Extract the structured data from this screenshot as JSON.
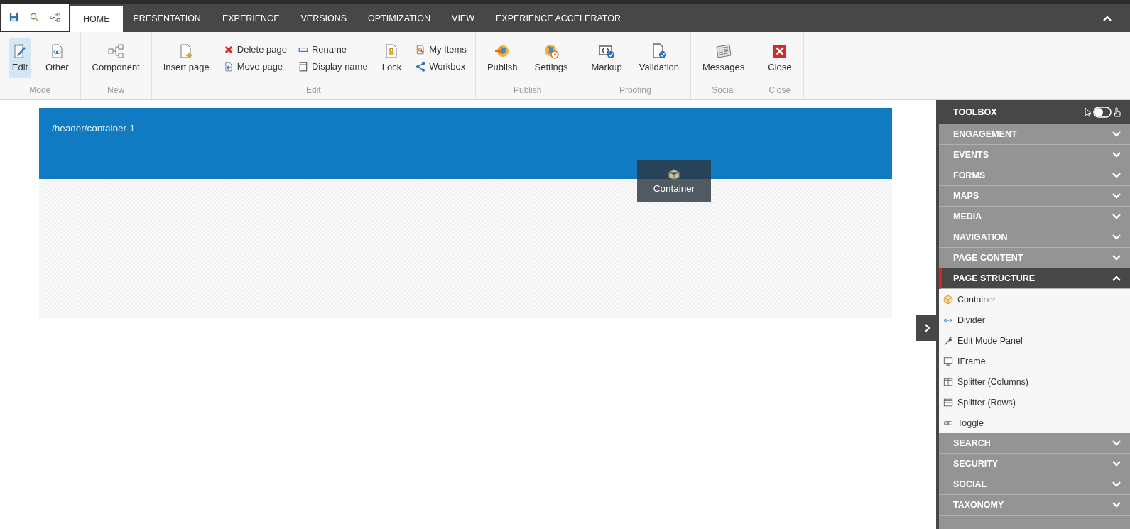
{
  "tabs": [
    {
      "label": "HOME",
      "selected": true
    },
    {
      "label": "PRESENTATION",
      "selected": false
    },
    {
      "label": "EXPERIENCE",
      "selected": false
    },
    {
      "label": "VERSIONS",
      "selected": false
    },
    {
      "label": "OPTIMIZATION",
      "selected": false
    },
    {
      "label": "VIEW",
      "selected": false
    },
    {
      "label": "EXPERIENCE ACCELERATOR",
      "selected": false
    }
  ],
  "ribbon": [
    {
      "label": "Mode",
      "items": [
        {
          "kind": "large",
          "buttons": [
            {
              "label": "Edit",
              "selected": true
            }
          ]
        },
        {
          "kind": "large",
          "buttons": [
            {
              "label": "Other",
              "selected": false
            }
          ]
        }
      ]
    },
    {
      "label": "New",
      "items": [
        {
          "kind": "large",
          "buttons": [
            {
              "label": "Component",
              "selected": false
            }
          ]
        }
      ]
    },
    {
      "label": "Edit",
      "items": [
        {
          "kind": "large",
          "buttons": [
            {
              "label": "Insert page",
              "selected": false
            }
          ]
        },
        {
          "kind": "stack",
          "buttons": [
            {
              "label": "Delete page",
              "selected": false
            },
            {
              "label": "Move page",
              "selected": false
            }
          ]
        },
        {
          "kind": "stack",
          "buttons": [
            {
              "label": "Rename",
              "selected": false
            },
            {
              "label": "Display name",
              "selected": false
            }
          ]
        },
        {
          "kind": "large",
          "buttons": [
            {
              "label": "Lock",
              "selected": false
            }
          ]
        },
        {
          "kind": "stack",
          "buttons": [
            {
              "label": "My Items",
              "selected": false
            },
            {
              "label": "Workbox",
              "selected": false
            }
          ]
        }
      ]
    },
    {
      "label": "Publish",
      "items": [
        {
          "kind": "large",
          "buttons": [
            {
              "label": "Publish",
              "selected": false
            }
          ]
        },
        {
          "kind": "large",
          "buttons": [
            {
              "label": "Settings",
              "selected": false
            }
          ]
        }
      ]
    },
    {
      "label": "Proofing",
      "items": [
        {
          "kind": "large",
          "buttons": [
            {
              "label": "Markup",
              "selected": false
            }
          ]
        },
        {
          "kind": "large",
          "buttons": [
            {
              "label": "Validation",
              "selected": false
            }
          ]
        }
      ]
    },
    {
      "label": "Social",
      "items": [
        {
          "kind": "large",
          "buttons": [
            {
              "label": "Messages",
              "selected": false
            }
          ]
        }
      ]
    },
    {
      "label": "Close",
      "items": [
        {
          "kind": "large",
          "buttons": [
            {
              "label": "Close",
              "selected": false
            }
          ]
        }
      ]
    }
  ],
  "canvas": {
    "path": "/header/container-1",
    "drag_chip": "Container"
  },
  "toolbox": {
    "title": "TOOLBOX",
    "sections": [
      {
        "title": "ENGAGEMENT",
        "expanded": false
      },
      {
        "title": "EVENTS",
        "expanded": false
      },
      {
        "title": "FORMS",
        "expanded": false
      },
      {
        "title": "MAPS",
        "expanded": false
      },
      {
        "title": "MEDIA",
        "expanded": false
      },
      {
        "title": "NAVIGATION",
        "expanded": false
      },
      {
        "title": "PAGE CONTENT",
        "expanded": false
      },
      {
        "title": "PAGE STRUCTURE",
        "expanded": true,
        "items": [
          "Container",
          "Divider",
          "Edit Mode Panel",
          "IFrame",
          "Splitter (Columns)",
          "Splitter (Rows)",
          "Toggle"
        ]
      },
      {
        "title": "SEARCH",
        "expanded": false
      },
      {
        "title": "SECURITY",
        "expanded": false
      },
      {
        "title": "SOCIAL",
        "expanded": false
      },
      {
        "title": "TAXONOMY",
        "expanded": false
      }
    ]
  }
}
